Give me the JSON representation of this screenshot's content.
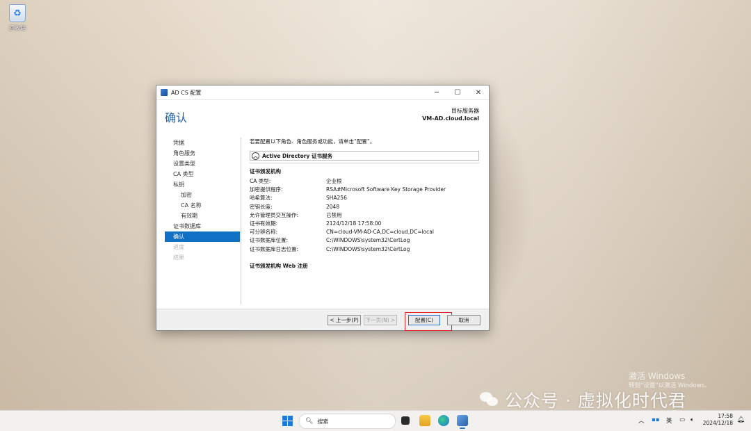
{
  "desktop": {
    "recycle_bin_label": "回收站"
  },
  "window": {
    "title": "AD CS 配置",
    "controls": {
      "minimize": "─",
      "maximize": "☐",
      "close": "✕"
    },
    "page_title": "确认",
    "target_label": "目标服务器",
    "target_server": "VM-AD.cloud.local",
    "nav": [
      {
        "label": "凭据",
        "state": "normal",
        "level": 0
      },
      {
        "label": "角色服务",
        "state": "normal",
        "level": 0
      },
      {
        "label": "设置类型",
        "state": "normal",
        "level": 0
      },
      {
        "label": "CA 类型",
        "state": "normal",
        "level": 0
      },
      {
        "label": "私钥",
        "state": "normal",
        "level": 0
      },
      {
        "label": "加密",
        "state": "normal",
        "level": 1
      },
      {
        "label": "CA 名称",
        "state": "normal",
        "level": 1
      },
      {
        "label": "有效期",
        "state": "normal",
        "level": 1
      },
      {
        "label": "证书数据库",
        "state": "normal",
        "level": 0
      },
      {
        "label": "确认",
        "state": "active",
        "level": 0
      },
      {
        "label": "进度",
        "state": "disabled",
        "level": 0
      },
      {
        "label": "结果",
        "state": "disabled",
        "level": 0
      }
    ],
    "intro": "若要配置以下角色、角色服务或功能，请单击“配置”。",
    "section_title": "Active Directory 证书服务",
    "group1_title": "证书颁发机构",
    "details": [
      {
        "key": "CA 类型:",
        "value": "企业根"
      },
      {
        "key": "加密提供程序:",
        "value": "RSA#Microsoft Software Key Storage Provider"
      },
      {
        "key": "哈希算法:",
        "value": "SHA256"
      },
      {
        "key": "密钥长度:",
        "value": "2048"
      },
      {
        "key": "允许管理员交互操作:",
        "value": "已禁用"
      },
      {
        "key": "证书有效期:",
        "value": "2124/12/18 17:58:00"
      },
      {
        "key": "可分辨名称:",
        "value": "CN=cloud-VM-AD-CA,DC=cloud,DC=local"
      },
      {
        "key": "证书数据库位置:",
        "value": "C:\\WINDOWS\\system32\\CertLog"
      },
      {
        "key": "证书数据库日志位置:",
        "value": "C:\\WINDOWS\\system32\\CertLog"
      }
    ],
    "group2_title": "证书颁发机构 Web 注册",
    "buttons": {
      "prev": "< 上一步(P)",
      "next": "下一页(N) >",
      "configure": "配置(C)",
      "cancel": "取消"
    }
  },
  "watermark": {
    "activate_title": "激活 Windows",
    "activate_sub": "转到“设置”以激活 Windows。",
    "wechat": "公众号 · 虚拟化时代君"
  },
  "taskbar": {
    "search_placeholder": "搜索",
    "ime": "英",
    "time": "17:58",
    "date": "2024/12/18"
  }
}
